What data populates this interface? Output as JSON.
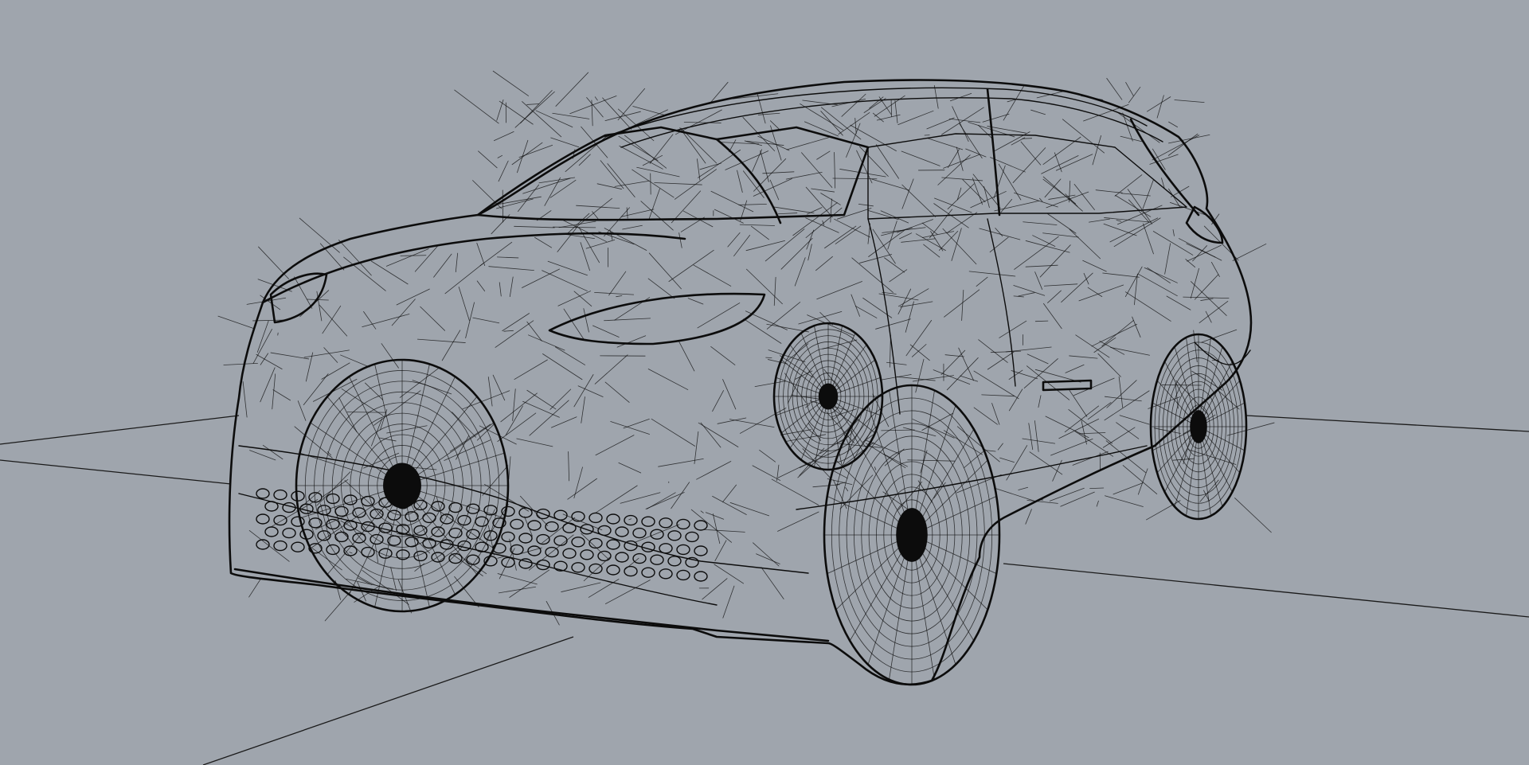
{
  "viewport": {
    "background_color": "#9fa5ad",
    "wire_color": "#0c0c0c",
    "render_mode": "wireframe"
  },
  "scene": {
    "object": "car-wireframe-model",
    "ground_grid": true
  }
}
